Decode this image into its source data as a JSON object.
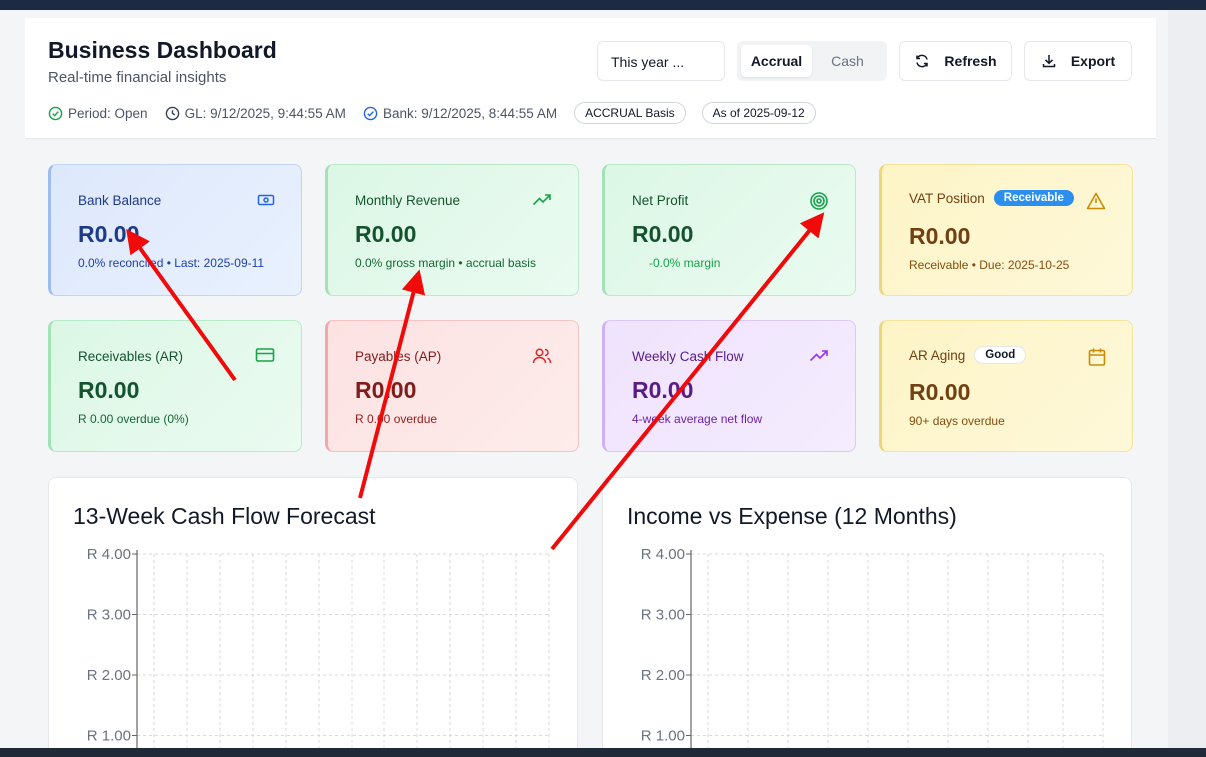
{
  "header": {
    "title": "Business Dashboard",
    "subtitle": "Real-time financial insights",
    "status": {
      "period": "Period: Open",
      "gl": "GL: 9/12/2025, 9:44:55 AM",
      "bank": "Bank: 9/12/2025, 8:44:55 AM",
      "basis_pill": "ACCRUAL Basis",
      "asof_pill": "As of 2025-09-12"
    },
    "period_select": "This year ...",
    "basis_toggle": {
      "accrual": "Accrual",
      "cash": "Cash",
      "selected": "Accrual"
    },
    "refresh_label": "Refresh",
    "export_label": "Export"
  },
  "kpis": [
    {
      "label": "Bank Balance",
      "value": "R0.00",
      "sub": "0.0% reconciled • Last: 2025-09-11",
      "icon": "banknote-icon",
      "color": "#1e3a8a"
    },
    {
      "label": "Monthly Revenue",
      "value": "R0.00",
      "sub": "0.0% gross margin • accrual basis",
      "icon": "trending-up-icon",
      "color": "#14532d"
    },
    {
      "label": "Net Profit",
      "value": "R0.00",
      "sub": "-0.0% margin",
      "icon": "target-icon",
      "color": "#14532d"
    },
    {
      "label": "VAT Position",
      "badge": "Receivable",
      "value": "R0.00",
      "sub": "Receivable • Due: 2025-10-25",
      "icon": "alert-triangle-icon",
      "color": "#713f12"
    },
    {
      "label": "Receivables (AR)",
      "value": "R0.00",
      "sub": "R 0.00 overdue (0%)",
      "icon": "credit-card-icon",
      "color": "#14532d"
    },
    {
      "label": "Payables (AP)",
      "value": "R0.00",
      "sub": "R 0.00 overdue",
      "icon": "users-icon",
      "color": "#7f1d1d"
    },
    {
      "label": "Weekly Cash Flow",
      "value": "R0.00",
      "sub": "4-week average net flow",
      "icon": "trending-up-icon",
      "color": "#581c87"
    },
    {
      "label": "AR Aging",
      "badge": "Good",
      "value": "R0.00",
      "sub": "90+ days overdue",
      "icon": "calendar-icon",
      "color": "#713f12"
    }
  ],
  "charts": {
    "cashflow_title": "13-Week Cash Flow Forecast",
    "income_title": "Income vs Expense (12 Months)"
  },
  "chart_data": [
    {
      "type": "bar",
      "title": "13-Week Cash Flow Forecast",
      "y_ticks": [
        "R 4.00",
        "R 3.00",
        "R 2.00",
        "R 1.00"
      ],
      "ylim": [
        0,
        4
      ],
      "grid": true,
      "series": []
    },
    {
      "type": "bar",
      "title": "Income vs Expense (12 Months)",
      "y_ticks": [
        "R 4.00",
        "R 3.00",
        "R 2.00",
        "R 1.00"
      ],
      "ylim": [
        0,
        4
      ],
      "grid": true,
      "series": []
    }
  ]
}
